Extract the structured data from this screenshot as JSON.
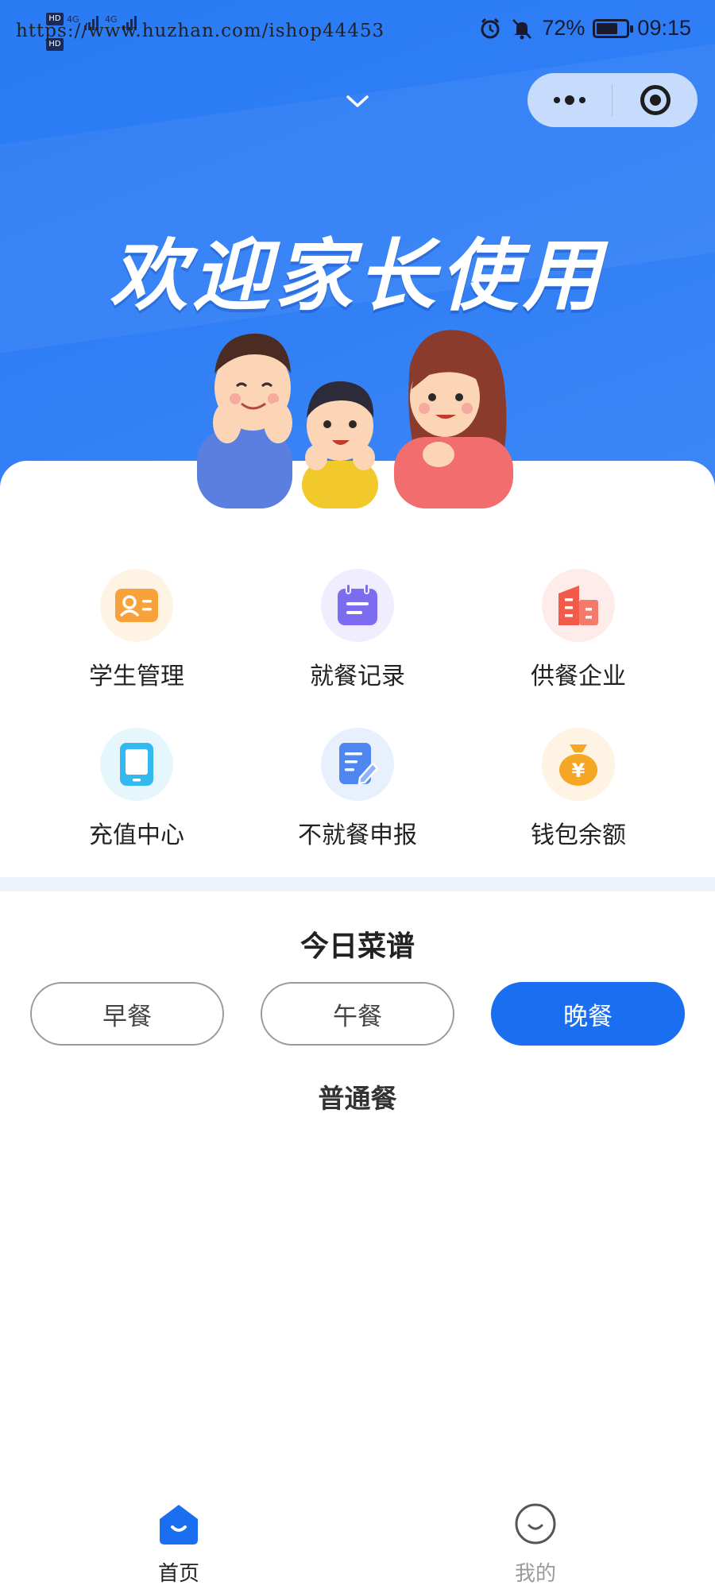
{
  "status_bar": {
    "watermark": "https://www.huzhan.com/ishop44453",
    "network_badges": [
      "HD",
      "HD"
    ],
    "network_type_1": "4G",
    "network_type_2": "4G",
    "battery_percent": "72%",
    "battery_level": 0.72,
    "time": "09:15",
    "icons": [
      "alarm-icon",
      "bell-muted-icon",
      "battery-icon"
    ]
  },
  "mini_program_capsule": {
    "icons": [
      "more-icon",
      "close-target-icon"
    ]
  },
  "hero": {
    "welcome_text": "欢迎家长使用",
    "illustration": "family-illustration",
    "colors": {
      "background": "#2f7ef6"
    }
  },
  "grid": {
    "items": [
      {
        "label": "学生管理",
        "icon": "student-card-icon",
        "color": "#f7a23a",
        "bg": "#fff3e3"
      },
      {
        "label": "就餐记录",
        "icon": "calendar-icon",
        "color": "#7c6cf0",
        "bg": "#efedfe"
      },
      {
        "label": "供餐企业",
        "icon": "building-icon",
        "color": "#f25a4a",
        "bg": "#fdecea"
      },
      {
        "label": "充值中心",
        "icon": "tablet-icon",
        "color": "#33b8f0",
        "bg": "#e5f6fd"
      },
      {
        "label": "不就餐申报",
        "icon": "edit-doc-icon",
        "color": "#4f86f0",
        "bg": "#e8effd"
      },
      {
        "label": "钱包余额",
        "icon": "money-bag-icon",
        "color": "#f5a623",
        "bg": "#fff3e3"
      }
    ]
  },
  "menu": {
    "title": "今日菜谱",
    "tabs": [
      {
        "label": "早餐",
        "active": false
      },
      {
        "label": "午餐",
        "active": false
      },
      {
        "label": "晚餐",
        "active": true
      }
    ],
    "meal_type": "普通餐",
    "colors": {
      "active": "#1a6ff0"
    }
  },
  "tabbar": {
    "items": [
      {
        "label": "首页",
        "icon": "home-icon",
        "active": true
      },
      {
        "label": "我的",
        "icon": "profile-smile-icon",
        "active": false
      }
    ],
    "colors": {
      "active": "#1a6ff0",
      "inactive": "#9a9a9a"
    }
  }
}
